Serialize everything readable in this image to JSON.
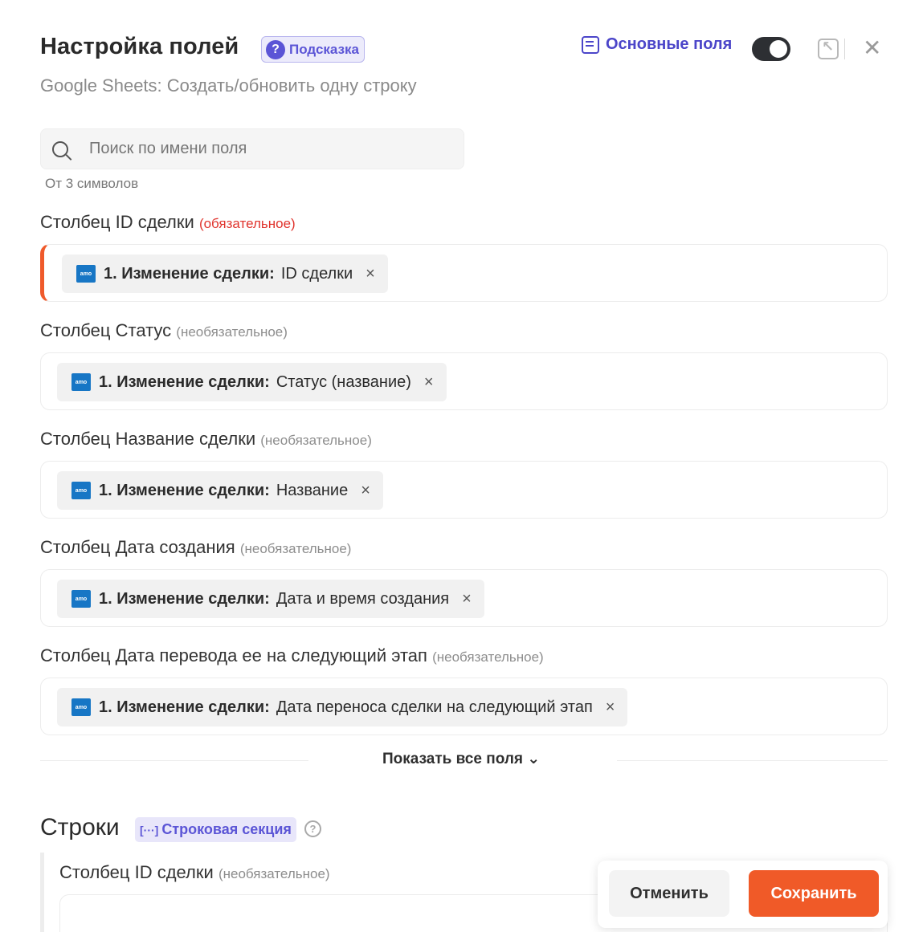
{
  "header": {
    "title": "Настройка полей",
    "hint_label": "Подсказка",
    "subtitle": "Google Sheets: Создать/обновить одну строку",
    "main_fields_label": "Основные поля",
    "main_fields_toggle_on": true
  },
  "search": {
    "placeholder": "Поиск по имени поля",
    "hint": "От 3 символов"
  },
  "fields": [
    {
      "label": "Столбец ID сделки",
      "qualifier": "(обязательное)",
      "required": true,
      "chip_step": "1. Изменение сделки:",
      "chip_value": "ID сделки",
      "chip_remove": "×"
    },
    {
      "label": "Столбец Статус",
      "qualifier": "(необязательное)",
      "required": false,
      "chip_step": "1. Изменение сделки:",
      "chip_value": "Статус (название)",
      "chip_remove": "×"
    },
    {
      "label": "Столбец Название сделки",
      "qualifier": "(необязательное)",
      "required": false,
      "chip_step": "1. Изменение сделки:",
      "chip_value": "Название",
      "chip_remove": "×"
    },
    {
      "label": "Столбец Дата создания",
      "qualifier": "(необязательное)",
      "required": false,
      "chip_step": "1. Изменение сделки:",
      "chip_value": "Дата и время создания",
      "chip_remove": "×"
    },
    {
      "label": "Столбец Дата перевода ее на следующий этап",
      "qualifier": "(необязательное)",
      "required": false,
      "chip_step": "1. Изменение сделки:",
      "chip_value": "Дата переноса сделки на следующий этап",
      "chip_remove": "×"
    }
  ],
  "chip_icon_text": "amo",
  "show_all_label": "Показать все поля ⌄",
  "rows_section": {
    "title": "Строки",
    "badge_icon": "[···]",
    "badge_label": "Строковая секция",
    "help_icon": "?",
    "field_label": "Столбец ID сделки",
    "field_qualifier": "(необязательное)"
  },
  "actions": {
    "cancel_label": "Отменить",
    "save_label": "Сохранить"
  },
  "colors": {
    "accent": "#5b55d6",
    "save": "#f05a28",
    "required": "#e0342d",
    "amo": "#1776c5"
  }
}
